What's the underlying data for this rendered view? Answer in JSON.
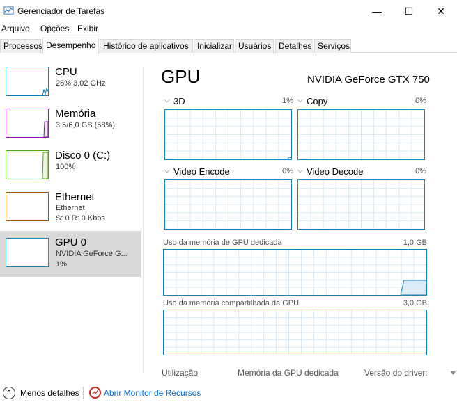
{
  "window": {
    "title": "Gerenciador de Tarefas",
    "minimize_glyph": "—",
    "maximize_glyph": "☐",
    "close_glyph": "✕"
  },
  "menu": [
    "Arquivo",
    "Opções",
    "Exibir"
  ],
  "tabs": [
    {
      "label": "Processos",
      "active": false
    },
    {
      "label": "Desempenho",
      "active": true
    },
    {
      "label": "Histórico de aplicativos",
      "active": false
    },
    {
      "label": "Inicializar",
      "active": false
    },
    {
      "label": "Usuários",
      "active": false
    },
    {
      "label": "Detalhes",
      "active": false
    },
    {
      "label": "Serviços",
      "active": false
    }
  ],
  "sidebar": [
    {
      "title": "CPU",
      "sub1": "26% 3,02 GHz",
      "sub2": "",
      "sub3": "",
      "color": "#117dbb"
    },
    {
      "title": "Memória",
      "sub1": "3,5/6,0 GB (58%)",
      "sub2": "",
      "sub3": "",
      "color": "#8b12ae"
    },
    {
      "title": "Disco 0 (C:)",
      "sub1": "100%",
      "sub2": "",
      "sub3": "",
      "color": "#4da60c"
    },
    {
      "title": "Ethernet",
      "sub1": "Ethernet",
      "sub2": "S: 0  R: 0 Kbps",
      "sub3": "",
      "color": "#a74f01"
    },
    {
      "title": "GPU 0",
      "sub1": "NVIDIA GeForce G...",
      "sub2": "1%",
      "sub3": "",
      "color": "#1b83c4"
    }
  ],
  "main": {
    "heading": "GPU",
    "model": "NVIDIA GeForce GTX 750",
    "engines": [
      {
        "label": "3D",
        "percent": "1%"
      },
      {
        "label": "Copy",
        "percent": "0%"
      },
      {
        "label": "Video Encode",
        "percent": "0%"
      },
      {
        "label": "Video Decode",
        "percent": "0%"
      }
    ],
    "dedicated_label": "Uso da memória de GPU dedicada",
    "dedicated_max": "1,0 GB",
    "shared_label": "Uso da memória compartilhada da GPU",
    "shared_max": "3,0 GB",
    "footer": [
      "Utilização",
      "Memória da GPU dedicada",
      "Versão do driver:"
    ]
  },
  "bottom": {
    "less_details": "Menos detalhes",
    "resource_monitor": "Abrir Monitor de Recursos"
  },
  "colors": {
    "accent": "#1b83c4",
    "grid": "#d9eaf5"
  }
}
